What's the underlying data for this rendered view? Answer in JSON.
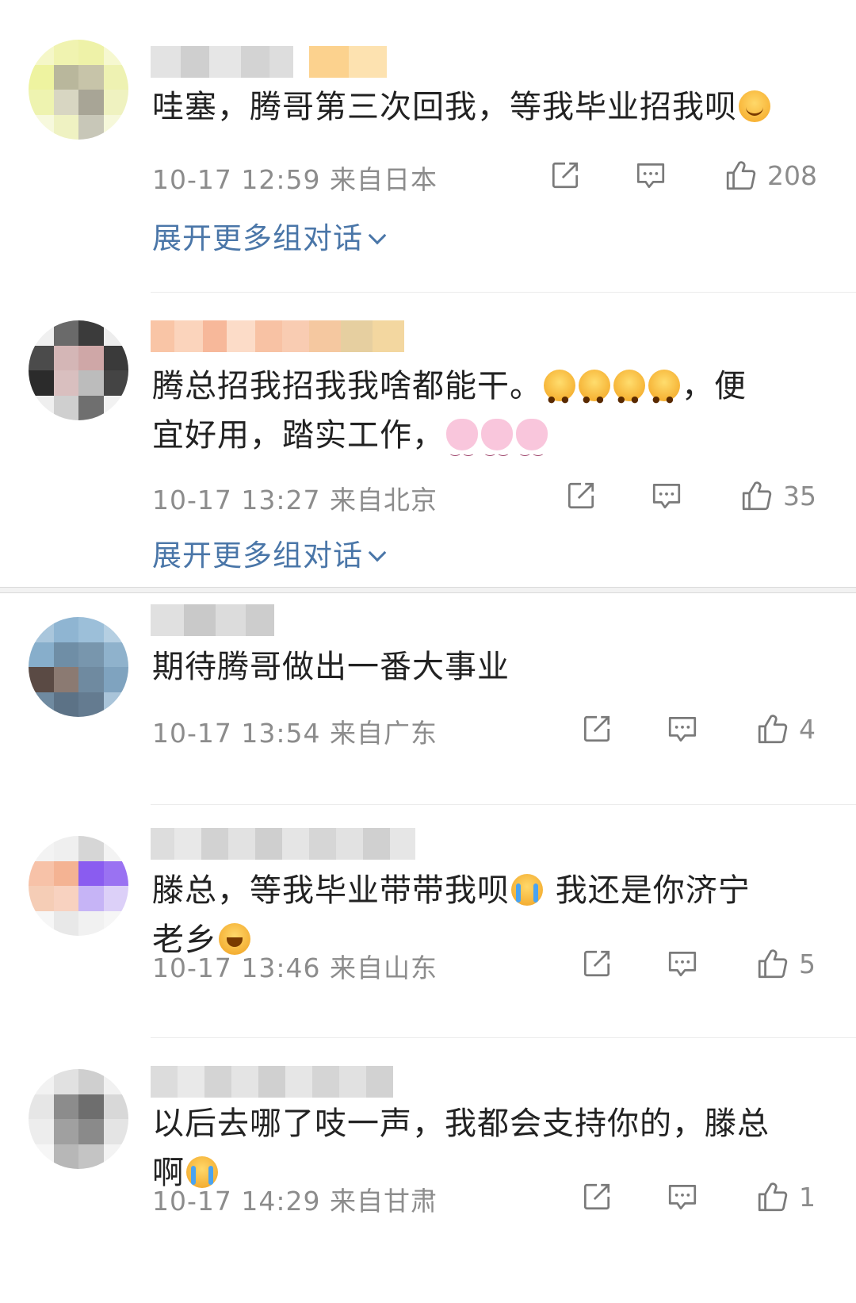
{
  "comments": [
    {
      "text": "哇塞，腾哥第三次回我，等我毕业招我呗",
      "time": "10-17 12:59",
      "location": "来自日本",
      "likes": "208",
      "expand_label": "展开更多组对话",
      "emoji": [
        "smiling-blush-emoji"
      ]
    },
    {
      "text_line1": "腾总招我招我我啥都能干。",
      "text_line1_tail": "，便",
      "text_line2": "宜好用，踏实工作，",
      "time": "10-17 13:27",
      "location": "来自北京",
      "likes": "35",
      "expand_label": "展开更多组对话",
      "emoji": [
        "pleading-emoji",
        "pleading-emoji",
        "praying-emoji",
        "pleading-emoji",
        "bunny-emoji",
        "bunny-emoji",
        "bunny-emoji"
      ]
    },
    {
      "text": "期待腾哥做出一番大事业",
      "time": "10-17 13:54",
      "location": "来自广东",
      "likes": "4"
    },
    {
      "text_line1": "滕总，等我毕业带带我呗",
      "text_line1_tail": "我还是你济宁",
      "text_line2": "老乡",
      "time": "10-17 13:46",
      "location": "来自山东",
      "likes": "5",
      "emoji": [
        "crying-emoji",
        "laughing-crying-emoji"
      ]
    },
    {
      "text_line1": "以后去哪了吱一声，我都会支持你的，滕总",
      "text_line2": "啊",
      "time": "10-17 14:29",
      "location": "来自甘肃",
      "likes": "1",
      "emoji": [
        "crying-emoji"
      ]
    }
  ],
  "icons": {
    "share": "share-icon",
    "comment": "comment-icon",
    "like": "thumbs-up-icon"
  },
  "colors": {
    "link": "#4a76a8",
    "meta": "#8c8c8c",
    "text": "#222222"
  }
}
